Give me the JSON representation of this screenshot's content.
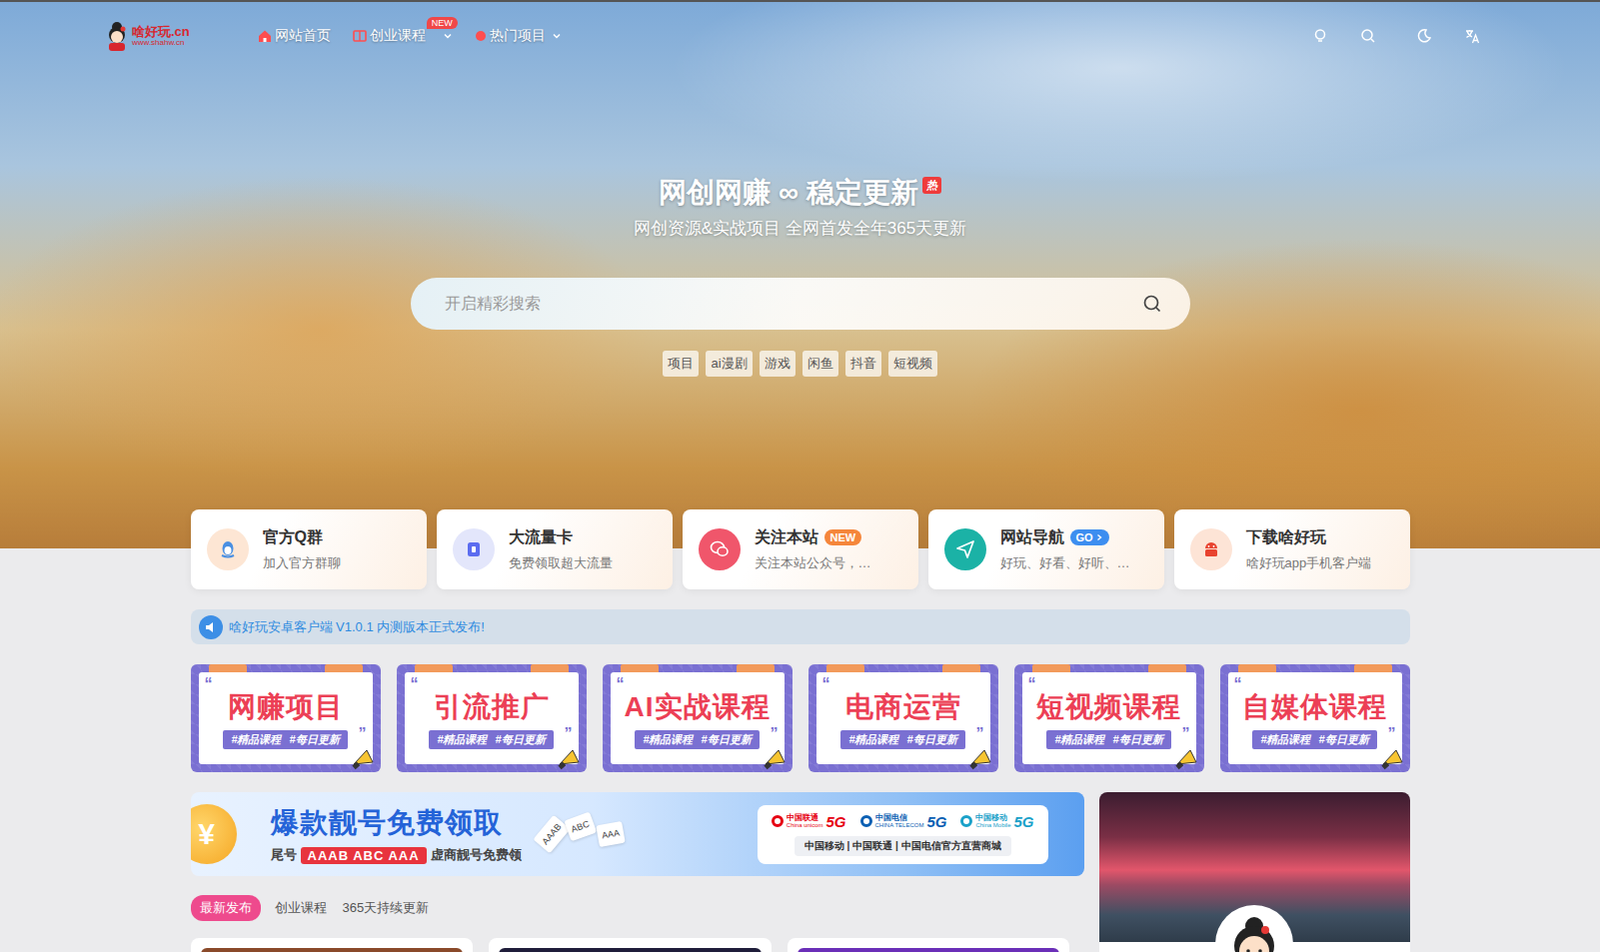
{
  "site": {
    "logo": "啥好玩.cn",
    "logo_sub": "www.shahw.cn"
  },
  "nav": [
    {
      "label": "网站首页",
      "badge": "",
      "dropdown": false,
      "color": "#ff4d4f"
    },
    {
      "label": "创业课程",
      "badge": "NEW",
      "dropdown": true,
      "color": "#ff4d4f"
    },
    {
      "label": "热门项目",
      "badge": "",
      "dropdown": true,
      "color": "#ff4d4f"
    }
  ],
  "hero": {
    "title": "网创网赚 ∞ 稳定更新",
    "badge": "热",
    "subtitle": "网创资源&实战项目 全网首发全年365天更新",
    "search": {
      "placeholder": "开启精彩搜索"
    },
    "tags": [
      "项目",
      "ai漫剧",
      "游戏",
      "闲鱼",
      "抖音",
      "短视频"
    ]
  },
  "quick_links": [
    {
      "title": "官方Q群",
      "desc": "加入官方群聊",
      "badge": "",
      "badge_color": "",
      "color": "#4a90e2",
      "bg": "#fde6d4"
    },
    {
      "title": "大流量卡",
      "desc": "免费领取超大流量",
      "badge": "",
      "badge_color": "",
      "color": "#5b6cf0",
      "bg": "#e3e6fb"
    },
    {
      "title": "关注本站",
      "desc": "关注本站公众号，…",
      "badge": "NEW",
      "badge_color": "#f5863b",
      "color": "#ffffff",
      "bg": "#f0566b"
    },
    {
      "title": "网站导航",
      "desc": "好玩、好看、好听、…",
      "badge": "GO",
      "badge_color": "#3d8ef0",
      "color": "#ffffff",
      "bg": "#1bb2a6"
    },
    {
      "title": "下载啥好玩",
      "desc": "啥好玩app手机客户端",
      "badge": "",
      "badge_color": "",
      "color": "#e8432f",
      "bg": "#fde4d6"
    }
  ],
  "notice": {
    "text": "啥好玩安卓客户端 V1.0.1 内测版本正式发布!"
  },
  "category_quotes": [
    "“",
    "”"
  ],
  "categories": [
    {
      "title": "网赚项目",
      "tags": [
        "#精品课程",
        "#每日更新"
      ]
    },
    {
      "title": "引流推广",
      "tags": [
        "#精品课程",
        "#每日更新"
      ]
    },
    {
      "title": "AI实战课程",
      "tags": [
        "#精品课程",
        "#每日更新"
      ]
    },
    {
      "title": "电商运营",
      "tags": [
        "#精品课程",
        "#每日更新"
      ]
    },
    {
      "title": "短视频课程",
      "tags": [
        "#精品课程",
        "#每日更新"
      ]
    },
    {
      "title": "自媒体课程",
      "tags": [
        "#精品课程",
        "#每日更新"
      ]
    }
  ],
  "ad": {
    "coin": "¥",
    "headline": "爆款靓号免费领取",
    "prefix": "尾号",
    "numbers": "AAAB ABC AAA",
    "suffix": "虚商靓号免费领",
    "cards": [
      "AAAB",
      "ABC",
      "AAA"
    ],
    "carriers": [
      {
        "name": "中国联通",
        "en": "China unicom",
        "net": "5G",
        "color": "#e60012"
      },
      {
        "name": "中国电信",
        "en": "CHINA TELECOM",
        "net": "5G",
        "color": "#0b5fb3"
      },
      {
        "name": "中国移动",
        "en": "China Mobile",
        "net": "5G",
        "color": "#1aa1c9"
      }
    ],
    "footer": "中国移动 | 中国联通 | 中国电信官方直营商城"
  },
  "tabs": [
    {
      "label": "最新发布",
      "selected": true
    },
    {
      "label": "创业课程",
      "selected": false
    },
    {
      "label": "365天持续更新",
      "selected": false
    }
  ],
  "posts": [
    {
      "color": "#8a4a2a"
    },
    {
      "color": "#1f1d3a"
    },
    {
      "color": "#6b2fb8"
    }
  ]
}
